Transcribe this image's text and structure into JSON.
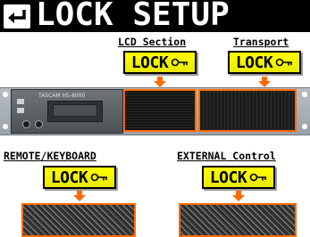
{
  "title": "LOCK SETUP",
  "back_button": {
    "icon": "return-arrow-icon"
  },
  "sections": [
    {
      "id": "lcd",
      "label": "LCD Section",
      "button_label": "LOCK",
      "icon": "key-icon"
    },
    {
      "id": "transport",
      "label": "Transport",
      "button_label": "LOCK",
      "icon": "key-icon"
    },
    {
      "id": "remote",
      "label": "REMOTE/KEYBOARD",
      "button_label": "LOCK",
      "icon": "key-icon"
    },
    {
      "id": "external",
      "label": "EXTERNAL Control",
      "button_label": "LOCK",
      "icon": "key-icon"
    }
  ],
  "device": {
    "brand_text": "TASCAM HS-8000"
  },
  "colors": {
    "title_bg": "#000000",
    "lock_button": "#ffff00",
    "highlight": "#ff6a00",
    "arrow": "#ff6a00"
  }
}
